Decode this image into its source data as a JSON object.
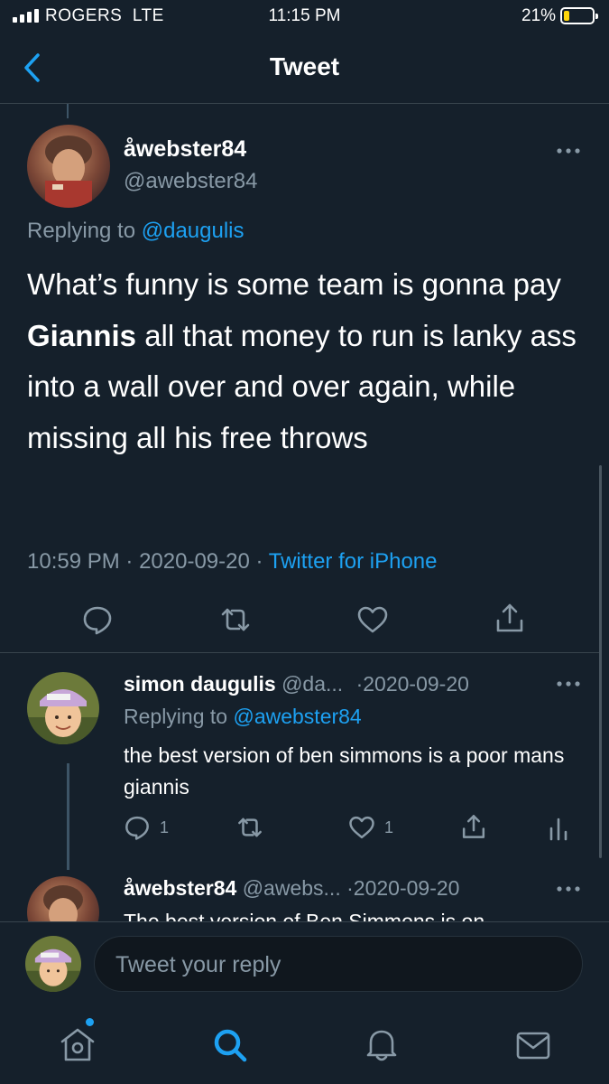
{
  "status_bar": {
    "carrier": "ROGERS  LTE",
    "time": "11:15 PM",
    "battery_pct": "21%",
    "battery_level": 0.21,
    "battery_color": "#ffd60a"
  },
  "nav": {
    "title": "Tweet",
    "back_icon": "chevron-left-icon"
  },
  "main_tweet": {
    "display_name": "åwebster84",
    "handle": "@awebster84",
    "replying_prefix": "Replying to",
    "replying_handle": "@daugulis",
    "text_before": "What’s funny is some team is gonna pay ",
    "text_bold": "Giannis",
    "text_after": " all that money to run is lanky ass into a wall over and over again, while missing all his free throws",
    "time": "10:59 PM",
    "date": "2020-09-20",
    "source": "Twitter for iPhone",
    "sep": "·"
  },
  "replies": [
    {
      "display_name": "simon daugulis",
      "handle": "@da...",
      "sep": "·",
      "date": "2020-09-20",
      "replying_prefix": "Replying to",
      "replying_handle": "@awebster84",
      "text": "the best version of ben simmons is a poor mans giannis",
      "reply_count": "1",
      "like_count": "1"
    },
    {
      "display_name": "åwebster84",
      "handle": "@awebs...",
      "sep": "·",
      "date": "2020-09-20",
      "text": "The best version of Ben Simmons is on"
    }
  ],
  "composer": {
    "placeholder": "Tweet your reply"
  },
  "tab_bar": [
    "home-icon",
    "search-icon",
    "notifications-icon",
    "messages-icon"
  ],
  "colors": {
    "background": "#15202b",
    "accent": "#1da1f2",
    "secondary_text": "#8899a6",
    "divider": "#38444d"
  }
}
